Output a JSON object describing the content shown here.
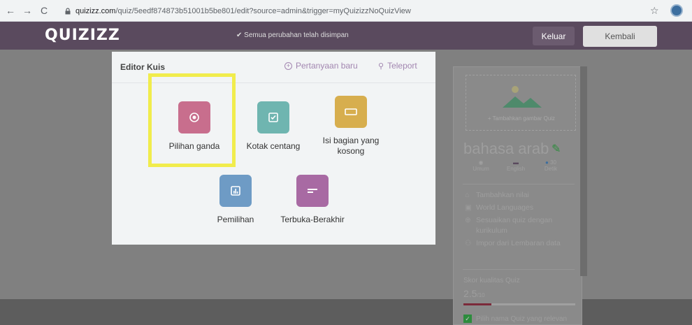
{
  "browser": {
    "url_domain": "quizizz.com",
    "url_path": "/quiz/5eedf874873b51001b5be801/edit?source=admin&trigger=myQuizizzNoQuizView"
  },
  "header": {
    "logo": "QUIZIZZ",
    "saved_status": "Semua perubahan telah disimpan",
    "keluar_label": "Keluar",
    "kembali_label": "Kembali"
  },
  "modal": {
    "title": "Editor Kuis",
    "new_question_label": "Pertanyaan baru",
    "teleport_label": "Teleport",
    "question_types": [
      {
        "label": "Pilihan ganda",
        "icon": "radio-icon",
        "color": "#c86e8d"
      },
      {
        "label": "Kotak centang",
        "icon": "checkbox-icon",
        "color": "#6fb5b0"
      },
      {
        "label": "Isi bagian yang kosong",
        "icon": "blank-icon",
        "color": "#d7ae4e"
      },
      {
        "label": "Pemilihan",
        "icon": "poll-icon",
        "color": "#6e9bc5"
      },
      {
        "label": "Terbuka-Berakhir",
        "icon": "open-ended-icon",
        "color": "#a86aa3"
      }
    ]
  },
  "sidebar": {
    "add_image_label": "+ Tambahkan gambar Quiz",
    "quiz_title": "bahasa arab",
    "meta": [
      {
        "label": "Umum",
        "icon": "eye-icon"
      },
      {
        "label": "English",
        "icon": "language-icon"
      },
      {
        "label": "Detik",
        "value": "30",
        "icon": "clock-icon"
      }
    ],
    "items": [
      {
        "label": "Tambahkan nilai",
        "icon": "graduation-cap-icon"
      },
      {
        "label": "World Languages",
        "icon": "book-icon"
      },
      {
        "label": "Sesuaikan quiz dengan kurikulum",
        "icon": "plus-circle-icon"
      },
      {
        "label": "Impor dari Lembaran data",
        "icon": "import-icon"
      }
    ],
    "score_label": "Skor kualitas Quiz",
    "score_value": "2.5",
    "score_max": "/10",
    "score_fraction": 0.25,
    "check_label": "Pilih nama Quiz yang relevan"
  },
  "colors": {
    "accent": "#a286b0",
    "highlight": "#f1ec4c",
    "header": "#5a4a5e"
  }
}
